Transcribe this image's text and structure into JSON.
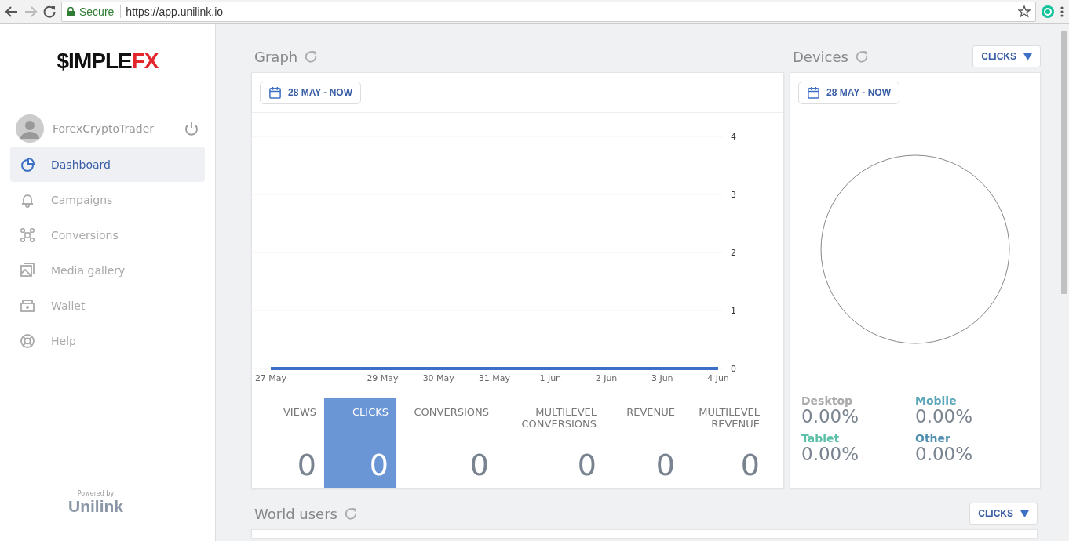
{
  "browser": {
    "secure_label": "Secure",
    "url": "https://app.unilink.io"
  },
  "sidebar": {
    "logo": {
      "main": "$IMPLE",
      "accent": "FX"
    },
    "user": "ForexCryptoTrader",
    "items": [
      {
        "kind": "dashboard",
        "label": "Dashboard",
        "selected": true
      },
      {
        "kind": "campaigns",
        "label": "Campaigns",
        "selected": false
      },
      {
        "kind": "conversions",
        "label": "Conversions",
        "selected": false
      },
      {
        "kind": "media",
        "label": "Media gallery",
        "selected": false
      },
      {
        "kind": "wallet",
        "label": "Wallet",
        "selected": false
      },
      {
        "kind": "help",
        "label": "Help",
        "selected": false
      }
    ],
    "powered_by": "Powered by",
    "brand": "Unilink"
  },
  "graph": {
    "title": "Graph",
    "date_range": "28 MAY - NOW",
    "chart_data": {
      "type": "line",
      "categories": [
        "27 May",
        null,
        "29 May",
        "30 May",
        "31 May",
        "1 Jun",
        "2 Jun",
        "3 Jun",
        "4 Jun"
      ],
      "series": [
        {
          "color": "#3d6fc4",
          "values": [
            0,
            0,
            0,
            0,
            0,
            0,
            0,
            0,
            0
          ]
        }
      ],
      "ylim": [
        0,
        4
      ],
      "yticks": [
        0,
        1,
        2,
        3,
        4
      ],
      "grid": true
    },
    "metrics": [
      {
        "label": "VIEWS",
        "value": "0",
        "selected": false
      },
      {
        "label": "CLICKS",
        "value": "0",
        "selected": true
      },
      {
        "label": "CONVERSIONS",
        "value": "0",
        "selected": false
      },
      {
        "label": "MULTILEVEL CONVERSIONS",
        "value": "0",
        "selected": false
      },
      {
        "label": "REVENUE",
        "value": "0",
        "selected": false
      },
      {
        "label": "MULTILEVEL REVENUE",
        "value": "0",
        "selected": false
      }
    ]
  },
  "devices": {
    "title": "Devices",
    "dropdown": "CLICKS",
    "date_range": "28 MAY - NOW",
    "legend": [
      {
        "label": "Desktop",
        "value": "0.00%",
        "color": "#aaaaaa"
      },
      {
        "label": "Mobile",
        "value": "0.00%",
        "color": "#5aa5b8"
      },
      {
        "label": "Tablet",
        "value": "0.00%",
        "color": "#5cc0a8"
      },
      {
        "label": "Other",
        "value": "0.00%",
        "color": "#4f8fb0"
      }
    ]
  },
  "world_users": {
    "title": "World users",
    "dropdown": "CLICKS"
  }
}
